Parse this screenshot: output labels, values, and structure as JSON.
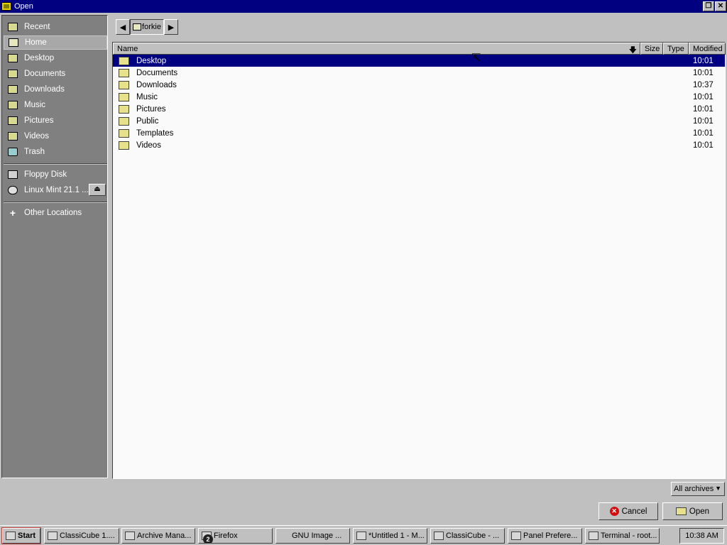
{
  "window": {
    "title": "Open"
  },
  "sidebar": {
    "items": [
      {
        "label": "Recent",
        "icon": "recent-icon"
      },
      {
        "label": "Home",
        "icon": "home-icon",
        "selected": true
      },
      {
        "label": "Desktop",
        "icon": "desktop-icon"
      },
      {
        "label": "Documents",
        "icon": "documents-folder-icon"
      },
      {
        "label": "Downloads",
        "icon": "downloads-folder-icon"
      },
      {
        "label": "Music",
        "icon": "music-folder-icon"
      },
      {
        "label": "Pictures",
        "icon": "pictures-folder-icon"
      },
      {
        "label": "Videos",
        "icon": "videos-folder-icon"
      },
      {
        "label": "Trash",
        "icon": "trash-icon"
      }
    ],
    "devices": [
      {
        "label": "Floppy Disk",
        "icon": "floppy-icon"
      },
      {
        "label": "Linux Mint 21.1 ...",
        "icon": "disc-icon",
        "eject": "⏏"
      }
    ],
    "other": {
      "label": "Other Locations",
      "icon": "plus-icon"
    }
  },
  "pathbar": {
    "back": "◀",
    "crumb": "forkie",
    "forward": "▶"
  },
  "columns": {
    "name": "Name",
    "size": "Size",
    "type": "Type",
    "modified": "Modified",
    "sort": "🡇"
  },
  "files": [
    {
      "name": "Desktop",
      "modified": "10:01",
      "selected": true
    },
    {
      "name": "Documents",
      "modified": "10:01"
    },
    {
      "name": "Downloads",
      "modified": "10:37"
    },
    {
      "name": "Music",
      "modified": "10:01"
    },
    {
      "name": "Pictures",
      "modified": "10:01"
    },
    {
      "name": "Public",
      "modified": "10:01"
    },
    {
      "name": "Templates",
      "modified": "10:01"
    },
    {
      "name": "Videos",
      "modified": "10:01"
    }
  ],
  "filter": {
    "value": "All archives",
    "caret": "▼"
  },
  "buttons": {
    "cancel": "Cancel",
    "open": "Open"
  },
  "taskbar": {
    "start": "Start",
    "tasks": [
      "ClassiCube 1....",
      "Archive Mana...",
      "Firefox",
      "GNU Image ...",
      "*Untitled 1 - M...",
      "ClassiCube - ...",
      "Panel Prefere...",
      "Terminal - root..."
    ],
    "firefox_badge": "2",
    "clock": "10:38 AM"
  }
}
